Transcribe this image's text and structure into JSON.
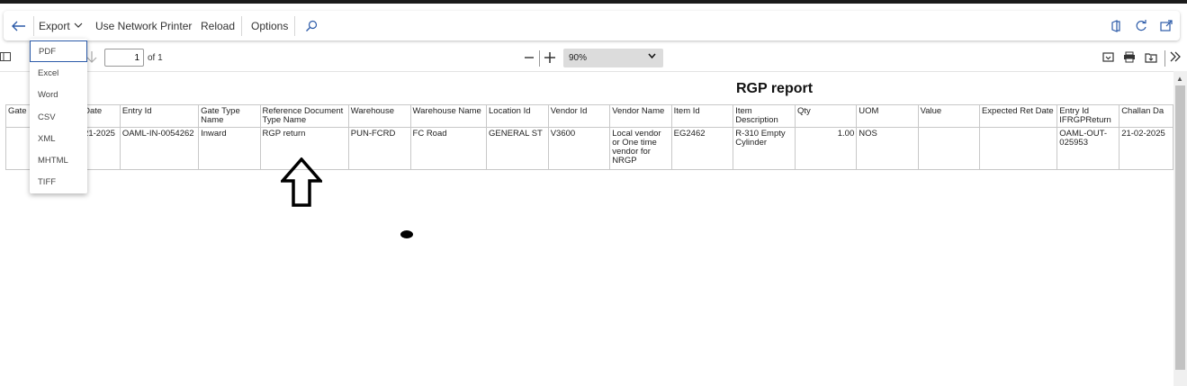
{
  "cmdbar": {
    "export_label": "Export",
    "printer_label": "Use Network Printer",
    "reload_label": "Reload",
    "options_label": "Options"
  },
  "viewer_toolbar": {
    "page_value": "1",
    "page_total": "of 1",
    "zoom_value": "90%"
  },
  "export_menu": {
    "items": [
      "PDF",
      "Excel",
      "Word",
      "CSV",
      "XML",
      "MHTML",
      "TIFF"
    ],
    "selected": "PDF"
  },
  "report": {
    "title": "RGP report",
    "columns": [
      "Gate E",
      "Date",
      "Entry Id",
      "Gate Type Name",
      "Reference Document Type Name",
      "Warehouse",
      "Warehouse Name",
      "Location Id",
      "Vendor Id",
      "Vendor Name",
      "Item Id",
      "Item Description",
      "Qty",
      "UOM",
      "Value",
      "Expected Ret Date",
      "Entry Id IFRGPReturn",
      "Challan Da"
    ],
    "rows": [
      [
        "",
        "21-2025",
        "OAML-IN-0054262",
        "Inward",
        "RGP return",
        "PUN-FCRD",
        "FC Road",
        "GENERAL ST",
        "V3600",
        "Local vendor or One time vendor for NRGP",
        "EG2462",
        "R-310 Empty Cylinder",
        "1.00",
        "NOS",
        "",
        "",
        "OAML-OUT-025953",
        "21-02-2025"
      ]
    ]
  },
  "colors": {
    "accent": "#2b5aa8",
    "top_strip": "#1b1b1b",
    "zoom_bg": "#dcdcdc"
  }
}
